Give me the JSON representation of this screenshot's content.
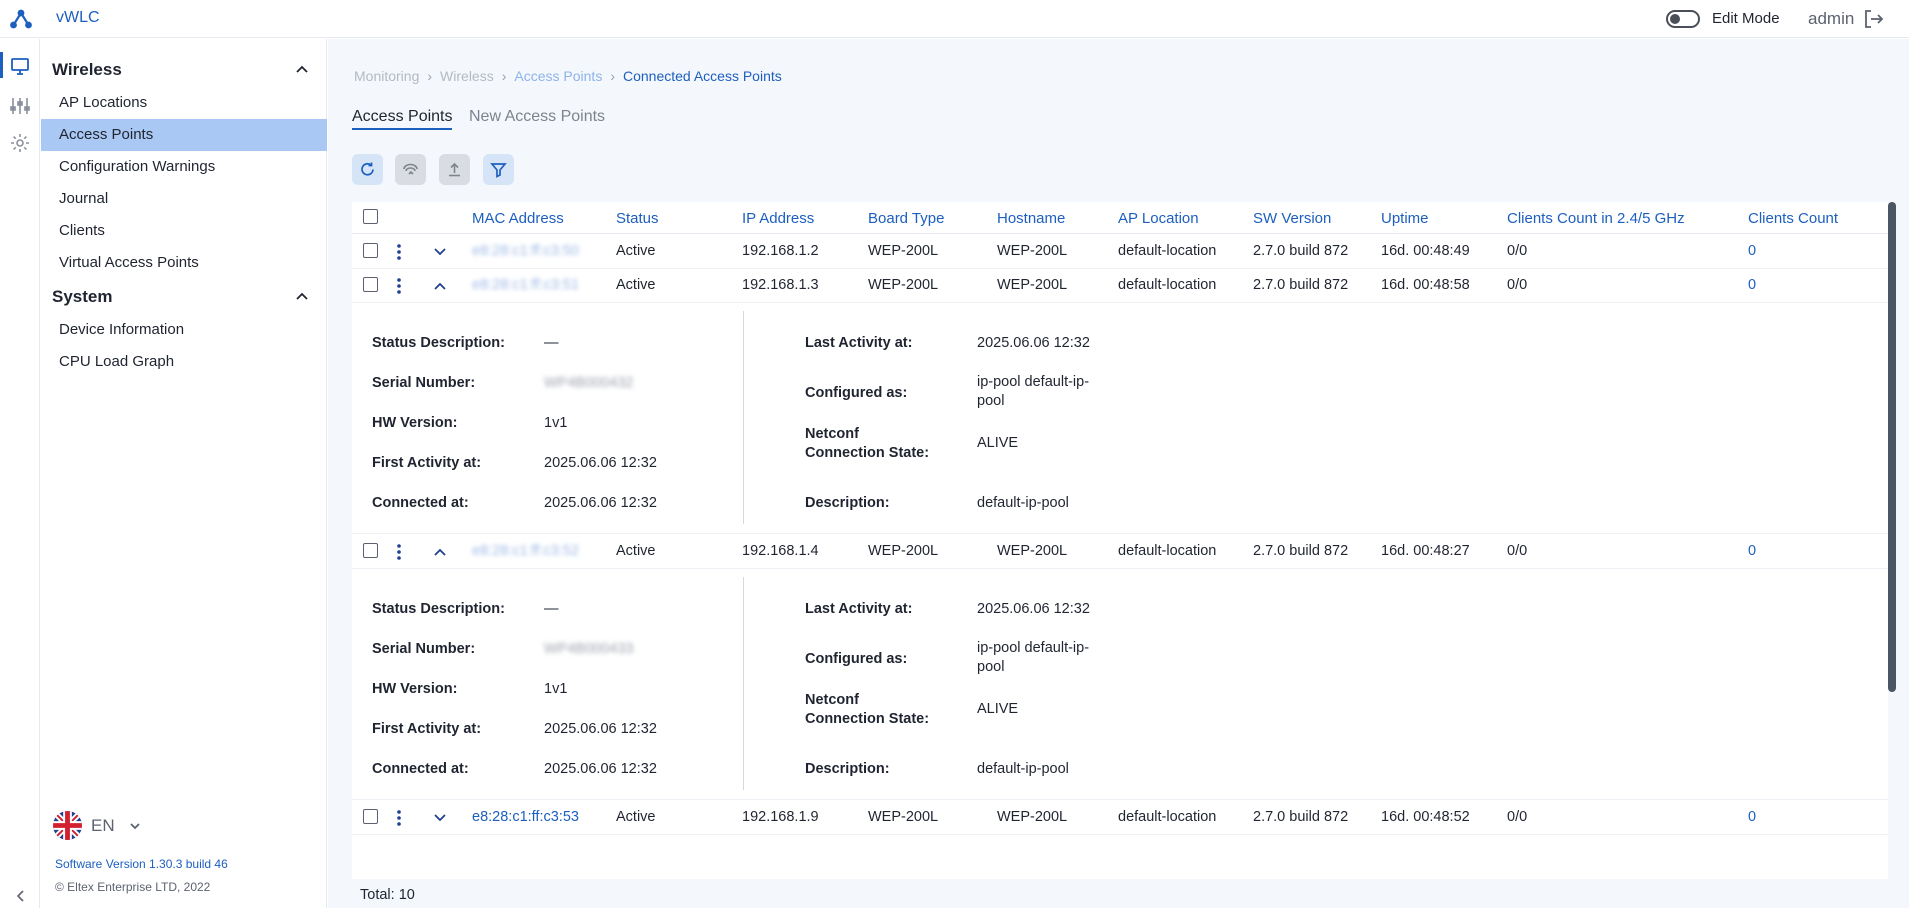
{
  "app": {
    "title": "vWLC"
  },
  "header": {
    "edit_mode_label": "Edit Mode",
    "user": "admin"
  },
  "sidebar": {
    "sections": [
      {
        "title": "Wireless",
        "items": [
          "AP Locations",
          "Access Points",
          "Configuration Warnings",
          "Journal",
          "Clients",
          "Virtual Access Points"
        ]
      },
      {
        "title": "System",
        "items": [
          "Device Information",
          "CPU Load Graph"
        ]
      }
    ],
    "active_item": "Access Points",
    "language": "EN",
    "software_version": "Software Version 1.30.3 build 46",
    "copyright": "© Eltex Enterprise LTD, 2022"
  },
  "breadcrumb": [
    "Monitoring",
    "Wireless",
    "Access Points",
    "Connected Access Points"
  ],
  "tabs": [
    "Access Points",
    "New Access Points"
  ],
  "table": {
    "columns": [
      "MAC Address",
      "Status",
      "IP Address",
      "Board Type",
      "Hostname",
      "AP Location",
      "SW Version",
      "Uptime",
      "Clients Count in 2.4/5 GHz",
      "Clients Count"
    ],
    "rows": [
      {
        "mac": "e8:28:c1:ff:c3:50",
        "status": "Active",
        "ip": "192.168.1.2",
        "board": "WEP-200L",
        "hostname": "WEP-200L",
        "location": "default-location",
        "sw": "2.7.0 build 872",
        "uptime": "16d. 00:48:49",
        "clients_band": "0/0",
        "clients": "0"
      },
      {
        "mac": "e8:28:c1:ff:c3:51",
        "status": "Active",
        "ip": "192.168.1.3",
        "board": "WEP-200L",
        "hostname": "WEP-200L",
        "location": "default-location",
        "sw": "2.7.0 build 872",
        "uptime": "16d. 00:48:58",
        "clients_band": "0/0",
        "clients": "0"
      },
      {
        "mac": "e8:28:c1:ff:c3:52",
        "status": "Active",
        "ip": "192.168.1.4",
        "board": "WEP-200L",
        "hostname": "WEP-200L",
        "location": "default-location",
        "sw": "2.7.0 build 872",
        "uptime": "16d. 00:48:27",
        "clients_band": "0/0",
        "clients": "0"
      },
      {
        "mac": "e8:28:c1:ff:c3:53",
        "status": "Active",
        "ip": "192.168.1.9",
        "board": "WEP-200L",
        "hostname": "WEP-200L",
        "location": "default-location",
        "sw": "2.7.0 build 872",
        "uptime": "16d. 00:48:52",
        "clients_band": "0/0",
        "clients": "0"
      }
    ],
    "detail_labels": {
      "status_description": "Status Description:",
      "serial_number": "Serial Number:",
      "hw_version": "HW Version:",
      "first_activity": "First Activity at:",
      "connected_at": "Connected at:",
      "last_activity": "Last Activity at:",
      "configured_as": "Configured as:",
      "netconf_state": "Netconf Connection State:",
      "description": "Description:"
    },
    "details": [
      {
        "status_description": "—",
        "serial_number": "WP4B000432",
        "hw_version": "1v1",
        "first_activity": "2025.06.06 12:32",
        "connected_at": "2025.06.06 12:32",
        "last_activity": "2025.06.06 12:32",
        "configured_as": "ip-pool default-ip-pool",
        "netconf_state": "ALIVE",
        "description": "default-ip-pool"
      },
      {
        "status_description": "—",
        "serial_number": "WP4B000433",
        "hw_version": "1v1",
        "first_activity": "2025.06.06 12:32",
        "connected_at": "2025.06.06 12:32",
        "last_activity": "2025.06.06 12:32",
        "configured_as": "ip-pool default-ip-pool",
        "netconf_state": "ALIVE",
        "description": "default-ip-pool"
      }
    ]
  },
  "total": {
    "label": "Total:",
    "value": "10"
  },
  "colors": {
    "accent": "#1d5fbf",
    "active_nav": "#a9c8f4",
    "background": "#f4f7fb"
  }
}
